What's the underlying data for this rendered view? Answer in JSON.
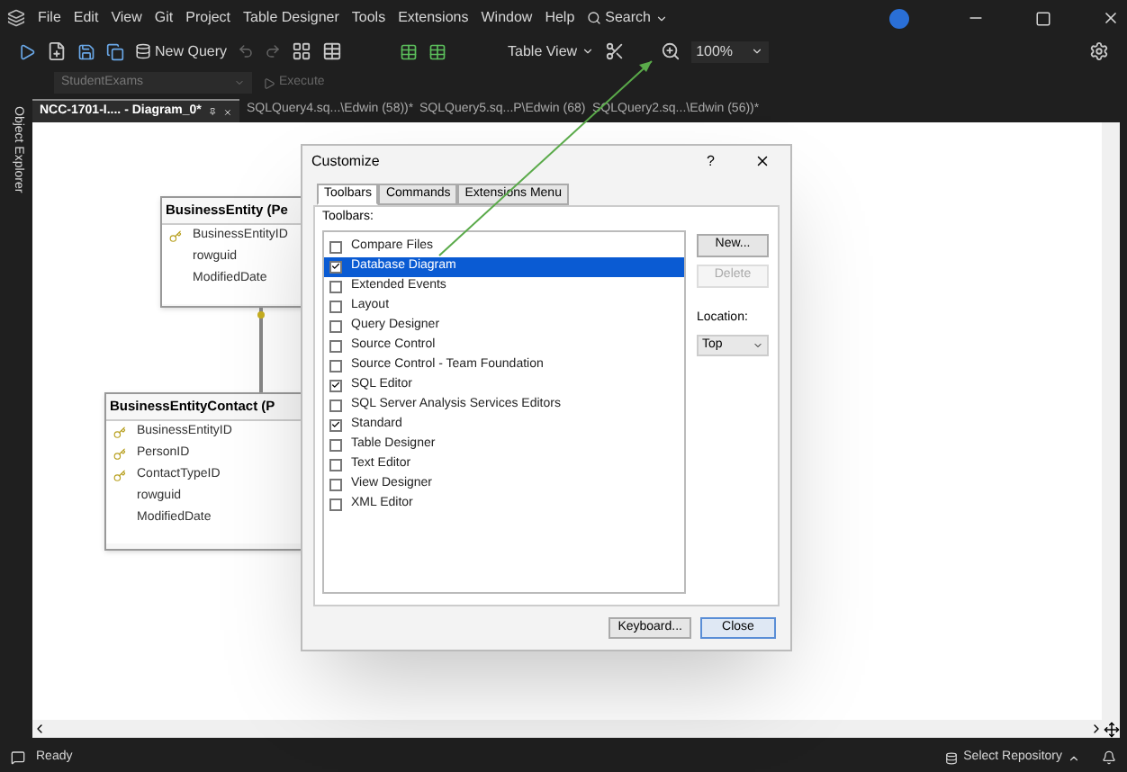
{
  "menu_bar": {
    "items": [
      "File",
      "Edit",
      "View",
      "Git",
      "Project",
      "Table Designer",
      "Tools",
      "Extensions",
      "Window",
      "Help"
    ],
    "search": "Search"
  },
  "toolbar": {
    "new_query": "New Query",
    "table_view": "Table View",
    "zoom": "100%"
  },
  "sql_toolbar": {
    "database": "StudentExams",
    "execute": {
      "label": "Execute",
      "disabled": true
    }
  },
  "side_panel": {
    "label": "Object Explorer"
  },
  "tabs": [
    {
      "label": "NCC-1701-I.... - Diagram_0*",
      "selected": true
    },
    {
      "label": "SQLQuery4.sq...\\Edwin (58))*",
      "selected": false
    },
    {
      "label": "SQLQuery5.sq...P\\Edwin (68)",
      "selected": false
    },
    {
      "label": "SQLQuery2.sq...\\Edwin (56))*",
      "selected": false
    }
  ],
  "diagram": {
    "tables": [
      {
        "title": "BusinessEntity (Pe",
        "columns": [
          {
            "name": "BusinessEntityID",
            "key": true
          },
          {
            "name": "rowguid",
            "key": false
          },
          {
            "name": "ModifiedDate",
            "key": false
          }
        ]
      },
      {
        "title": "BusinessEntityContact (P",
        "columns": [
          {
            "name": "BusinessEntityID",
            "key": true
          },
          {
            "name": "PersonID",
            "key": true
          },
          {
            "name": "ContactTypeID",
            "key": true
          },
          {
            "name": "rowguid",
            "key": false
          },
          {
            "name": "ModifiedDate",
            "key": false
          }
        ]
      }
    ]
  },
  "dialog": {
    "title": "Customize",
    "help": "?",
    "tabs": [
      {
        "label": "Toolbars",
        "selected": true
      },
      {
        "label": "Commands",
        "selected": false
      },
      {
        "label": "Extensions Menu",
        "selected": false
      }
    ],
    "list_label": "Toolbars:",
    "toolbars": [
      {
        "label": "Compare Files",
        "checked": false,
        "selected": false
      },
      {
        "label": "Database Diagram",
        "checked": true,
        "selected": true
      },
      {
        "label": "Extended Events",
        "checked": false,
        "selected": false
      },
      {
        "label": "Layout",
        "checked": false,
        "selected": false
      },
      {
        "label": "Query Designer",
        "checked": false,
        "selected": false
      },
      {
        "label": "Source Control",
        "checked": false,
        "selected": false
      },
      {
        "label": "Source Control - Team Foundation",
        "checked": false,
        "selected": false
      },
      {
        "label": "SQL Editor",
        "checked": true,
        "selected": false
      },
      {
        "label": "SQL Server Analysis Services Editors",
        "checked": false,
        "selected": false
      },
      {
        "label": "Standard",
        "checked": true,
        "selected": false
      },
      {
        "label": "Table Designer",
        "checked": false,
        "selected": false
      },
      {
        "label": "Text Editor",
        "checked": false,
        "selected": false
      },
      {
        "label": "View Designer",
        "checked": false,
        "selected": false
      },
      {
        "label": "XML Editor",
        "checked": false,
        "selected": false
      }
    ],
    "side_buttons": [
      {
        "label": "New...",
        "disabled": false
      },
      {
        "label": "Delete",
        "disabled": true
      }
    ],
    "location_label": "Location:",
    "location": "Top",
    "footer_buttons": [
      {
        "label": "Keyboard...",
        "primary": false
      },
      {
        "label": "Close",
        "primary": true
      }
    ]
  },
  "status_bar": {
    "status": "Ready",
    "repository": "Select Repository"
  }
}
